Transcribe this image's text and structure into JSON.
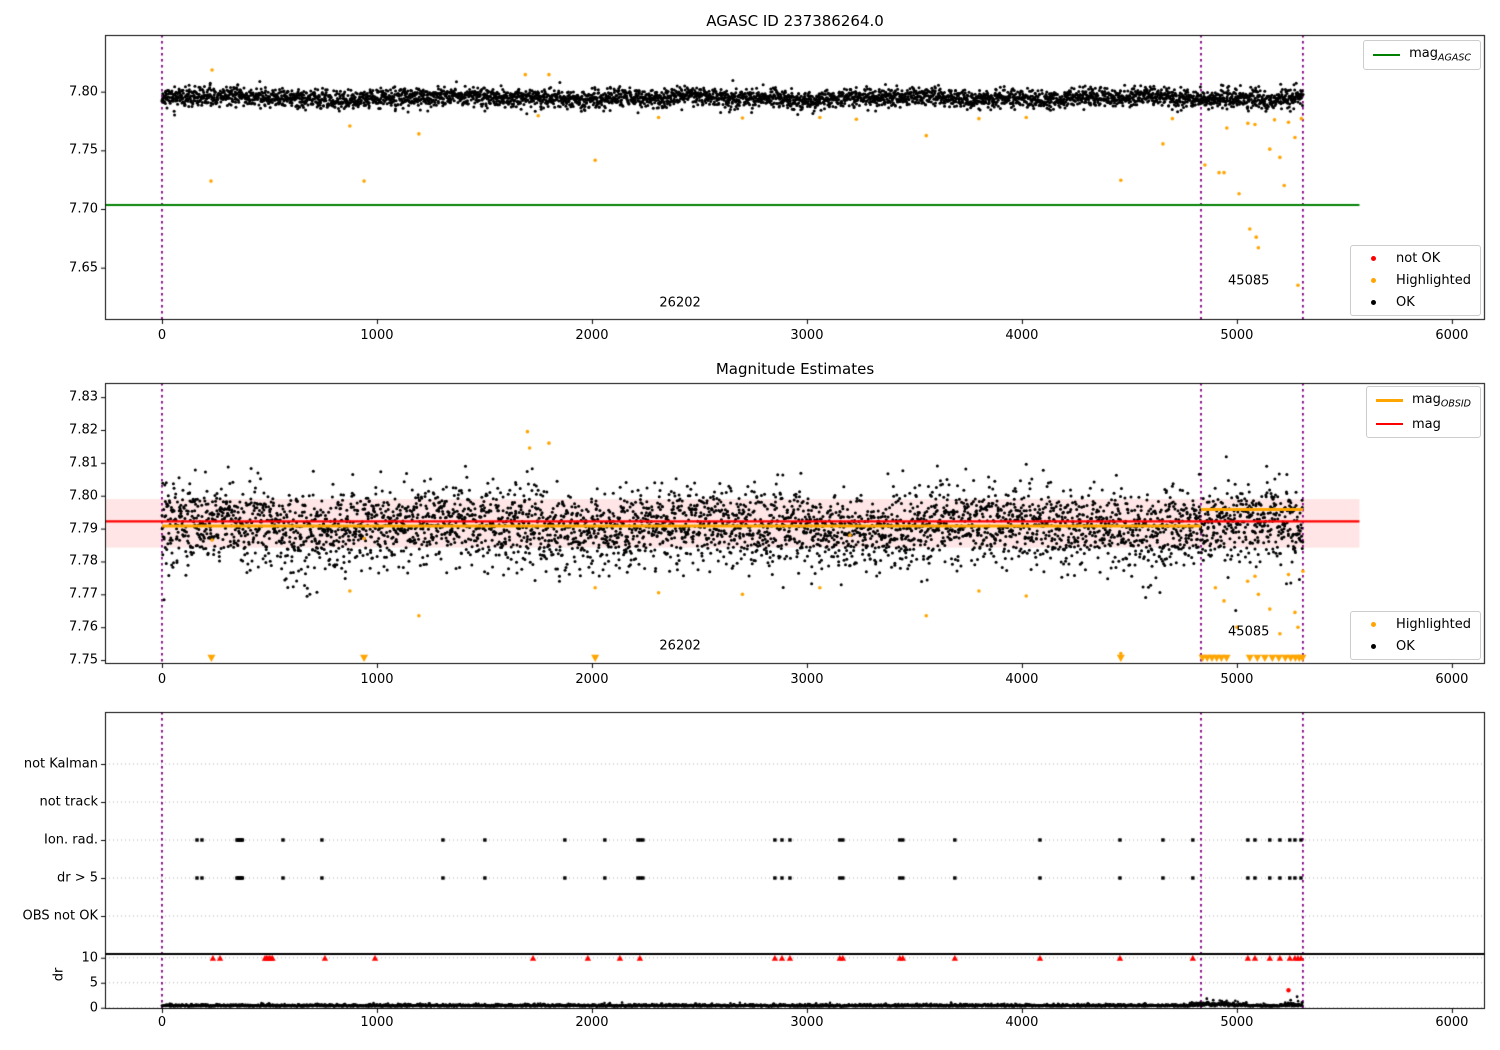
{
  "colors": {
    "ok": "#000000",
    "highlighted": "#ffa500",
    "not_ok": "#ff0000",
    "mag_agasc_line": "#008000",
    "mag_line": "#ff0000",
    "mag_obsid_line": "#ffa500",
    "band_fill": "rgba(255,0,0,0.10)",
    "vline": "#800080",
    "grid": "#b0b0b0",
    "spine": "#000000"
  },
  "legends": {
    "mag_agasc": {
      "main": "mag",
      "sub": "AGASC"
    },
    "mag_obsid": {
      "main": "mag",
      "sub": "OBSID"
    },
    "mag": {
      "label": "mag"
    },
    "not_ok": {
      "label": "not OK"
    },
    "highlighted": {
      "label": "Highlighted"
    },
    "ok": {
      "label": "OK"
    }
  },
  "annotations": {
    "obsid_left": "26202",
    "obsid_right": "45085"
  },
  "xaxis": {
    "ticks": [
      0,
      1000,
      2000,
      3000,
      4000,
      5000,
      6000
    ],
    "labels": [
      "0",
      "1000",
      "2000",
      "3000",
      "4000",
      "5000",
      "6000"
    ]
  },
  "top_plot": {
    "title": "AGASC ID 237386264.0",
    "ytick_labels": [
      "7.80",
      "7.75",
      "7.70",
      "7.65"
    ],
    "ytick_values": [
      7.8,
      7.75,
      7.7,
      7.65
    ]
  },
  "middle_plot": {
    "title": "Magnitude Estimates",
    "ytick_labels": [
      "7.83",
      "7.82",
      "7.81",
      "7.80",
      "7.79",
      "7.78",
      "7.77",
      "7.76",
      "7.75"
    ],
    "ytick_values": [
      7.83,
      7.82,
      7.81,
      7.8,
      7.79,
      7.78,
      7.77,
      7.76,
      7.75
    ]
  },
  "bottom_plot": {
    "row_labels": [
      "not Kalman",
      "not track",
      "Ion. rad.",
      "dr > 5",
      "OBS not OK"
    ],
    "dr_tick_labels": [
      "10",
      "5",
      "0"
    ],
    "dr_tick_values": [
      10,
      5,
      0
    ],
    "ylabel": "dr"
  },
  "chart_data": [
    {
      "type": "scatter",
      "title": "AGASC ID 237386264.0",
      "xlim": [
        -265,
        6154
      ],
      "ylim": [
        7.6054,
        7.8483
      ],
      "xticks": [
        0,
        1000,
        2000,
        3000,
        4000,
        5000,
        6000
      ],
      "yticks": [
        7.8,
        7.75,
        7.7,
        7.65
      ],
      "vlines": [
        0,
        4833,
        5307
      ],
      "mag_agasc_line": {
        "y": 7.7034,
        "x_range": [
          -265,
          5570
        ]
      },
      "ok_cloud": {
        "n": 4200,
        "x_range": [
          0,
          5307
        ],
        "mean": 7.7947,
        "sd": 0.004,
        "clip": [
          7.774,
          7.8215
        ],
        "seed": 11
      },
      "highlighted_points": [
        [
          233,
          7.8185
        ],
        [
          228,
          7.7238
        ],
        [
          874,
          7.7707
        ],
        [
          940,
          7.7238
        ],
        [
          1195,
          7.764
        ],
        [
          1690,
          7.8145
        ],
        [
          1800,
          7.8145
        ],
        [
          1750,
          7.7795
        ],
        [
          2015,
          7.7415
        ],
        [
          2310,
          7.778
        ],
        [
          2700,
          7.7775
        ],
        [
          3060,
          7.778
        ],
        [
          3230,
          7.7765
        ],
        [
          3555,
          7.7625
        ],
        [
          3800,
          7.777
        ],
        [
          4020,
          7.778
        ],
        [
          4460,
          7.7245
        ],
        [
          4656,
          7.7555
        ],
        [
          4700,
          7.777
        ],
        [
          4851,
          7.7375
        ],
        [
          4917,
          7.731
        ],
        [
          4940,
          7.731
        ],
        [
          4953,
          7.769
        ],
        [
          5010,
          7.713
        ],
        [
          5051,
          7.773
        ],
        [
          5060,
          7.683
        ],
        [
          5084,
          7.772
        ],
        [
          5090,
          7.676
        ],
        [
          5100,
          7.667
        ],
        [
          5153,
          7.751
        ],
        [
          5175,
          7.776
        ],
        [
          5200,
          7.744
        ],
        [
          5220,
          7.72
        ],
        [
          5240,
          7.774
        ],
        [
          5270,
          7.761
        ],
        [
          5284,
          7.635
        ],
        [
          5300,
          7.777
        ]
      ],
      "annotations": [
        {
          "label": "26202",
          "x": 2410,
          "y": 7.6195
        },
        {
          "label": "45085",
          "x": 5055,
          "y": 7.6386
        }
      ],
      "legend1": [
        "mag_AGASC"
      ],
      "legend2": [
        "not OK",
        "Highlighted",
        "OK"
      ]
    },
    {
      "type": "scatter",
      "title": "Magnitude Estimates",
      "xlim": [
        -265,
        6154
      ],
      "ylim": [
        7.7488,
        7.8343
      ],
      "xticks": [
        0,
        1000,
        2000,
        3000,
        4000,
        5000,
        6000
      ],
      "yticks": [
        7.83,
        7.82,
        7.81,
        7.8,
        7.79,
        7.78,
        7.77,
        7.76,
        7.75
      ],
      "vlines": [
        0,
        4833,
        5307
      ],
      "mag_line": {
        "y": 7.7922,
        "x_range": [
          -265,
          5570
        ]
      },
      "band": {
        "y0": 7.7842,
        "y1": 7.799,
        "x_range": [
          -265,
          5570
        ]
      },
      "obsid_line_segments": [
        {
          "x0": 0,
          "x1": 4833,
          "y": 7.7908
        },
        {
          "x0": 4833,
          "x1": 5307,
          "y": 7.7958
        }
      ],
      "ok_cloud": {
        "n": 4200,
        "x_range": [
          0,
          5307
        ],
        "mean": 7.7912,
        "sd": 0.0057,
        "clip": [
          7.7578,
          7.8138
        ],
        "tail_frac": 0.2,
        "tail_max": 0.008,
        "seed": 22
      },
      "highlighted_points": [
        [
          233,
          7.7865
        ],
        [
          874,
          7.771
        ],
        [
          940,
          7.787
        ],
        [
          1195,
          7.7635
        ],
        [
          1700,
          7.8195
        ],
        [
          1710,
          7.8145
        ],
        [
          1800,
          7.816
        ],
        [
          2015,
          7.772
        ],
        [
          2310,
          7.7705
        ],
        [
          2700,
          7.77
        ],
        [
          3060,
          7.772
        ],
        [
          3200,
          7.788
        ],
        [
          3555,
          7.7635
        ],
        [
          3800,
          7.771
        ],
        [
          4020,
          7.7695
        ],
        [
          4460,
          7.752
        ],
        [
          4900,
          7.772
        ],
        [
          4940,
          7.768
        ],
        [
          5000,
          7.76
        ],
        [
          5050,
          7.774
        ],
        [
          5084,
          7.7755
        ],
        [
          5100,
          7.77
        ],
        [
          5153,
          7.7655
        ],
        [
          5200,
          7.758
        ],
        [
          5240,
          7.776
        ],
        [
          5270,
          7.7645
        ],
        [
          5284,
          7.76
        ],
        [
          5307,
          7.777
        ]
      ],
      "highlighted_clipped_low_x": [
        230,
        940,
        2015,
        4460,
        4840,
        4862,
        4884,
        4906,
        4928,
        4952,
        5060,
        5095,
        5130,
        5165,
        5195,
        5225,
        5250,
        5272,
        5290,
        5305
      ],
      "clip_marker_y": 7.75,
      "annotations": [
        {
          "label": "26202",
          "x": 2410,
          "y": 7.7543
        },
        {
          "label": "45085",
          "x": 5055,
          "y": 7.7585
        }
      ],
      "legend1": [
        "mag_OBSID",
        "mag"
      ],
      "legend2": [
        "Highlighted",
        "OK"
      ]
    },
    {
      "type": "scatter",
      "rows": [
        "not Kalman",
        "not track",
        "Ion. rad.",
        "dr > 5",
        "OBS not OK"
      ],
      "xlim": [
        -265,
        6154
      ],
      "vlines": [
        0,
        4833,
        5307
      ],
      "ion_rad_x": [
        163,
        186,
        349,
        354,
        359,
        364,
        369,
        374,
        563,
        744,
        1307,
        1502,
        1874,
        2060,
        2214,
        2225,
        2237,
        2851,
        2884,
        2921,
        3153,
        3167,
        3432,
        3446,
        3688,
        4084,
        4456,
        4656,
        4795,
        5051,
        5084,
        5153,
        5200,
        5246,
        5270,
        5298
      ],
      "dr_gt5_x": [
        163,
        186,
        349,
        354,
        359,
        364,
        369,
        374,
        563,
        744,
        1307,
        1502,
        1874,
        2060,
        2214,
        2225,
        2237,
        2851,
        2884,
        2921,
        3153,
        3167,
        3432,
        3446,
        3688,
        4084,
        4456,
        4656,
        4795,
        5051,
        5084,
        5153,
        5200,
        5246,
        5270,
        5298
      ],
      "not_ok_clipped_x": [
        237,
        270,
        479,
        486,
        493,
        500,
        507,
        514,
        758,
        991,
        1726,
        1981,
        2130,
        2223,
        2851,
        2884,
        2921,
        3153,
        3167,
        3432,
        3446,
        3688,
        4084,
        4456,
        4795,
        5051,
        5084,
        5153,
        5200,
        5246,
        5270,
        5284,
        5298
      ],
      "not_ok_clip_y": 10,
      "not_ok_point": {
        "x": 5240,
        "y": 3.5
      },
      "dr_ylim": [
        -0.25,
        10.75
      ],
      "dr_yticks": [
        10,
        5,
        0
      ],
      "dr_hline": 10.55,
      "dr_trace": {
        "n": 3200,
        "x_range": [
          0,
          5307
        ],
        "base": 0.28,
        "sd": 0.2,
        "clip": [
          0.04,
          1.9
        ],
        "seed": 33,
        "bumps": [
          {
            "x0": 4780,
            "x1": 5050,
            "amp": 0.9
          },
          {
            "x0": 5200,
            "x1": 5307,
            "amp": 0.6
          }
        ]
      },
      "dr_spikes": [
        [
          4860,
          1.8
        ],
        [
          4890,
          1.5
        ],
        [
          4930,
          1.3
        ],
        [
          5250,
          1.5
        ],
        [
          5280,
          2.2
        ]
      ]
    }
  ]
}
